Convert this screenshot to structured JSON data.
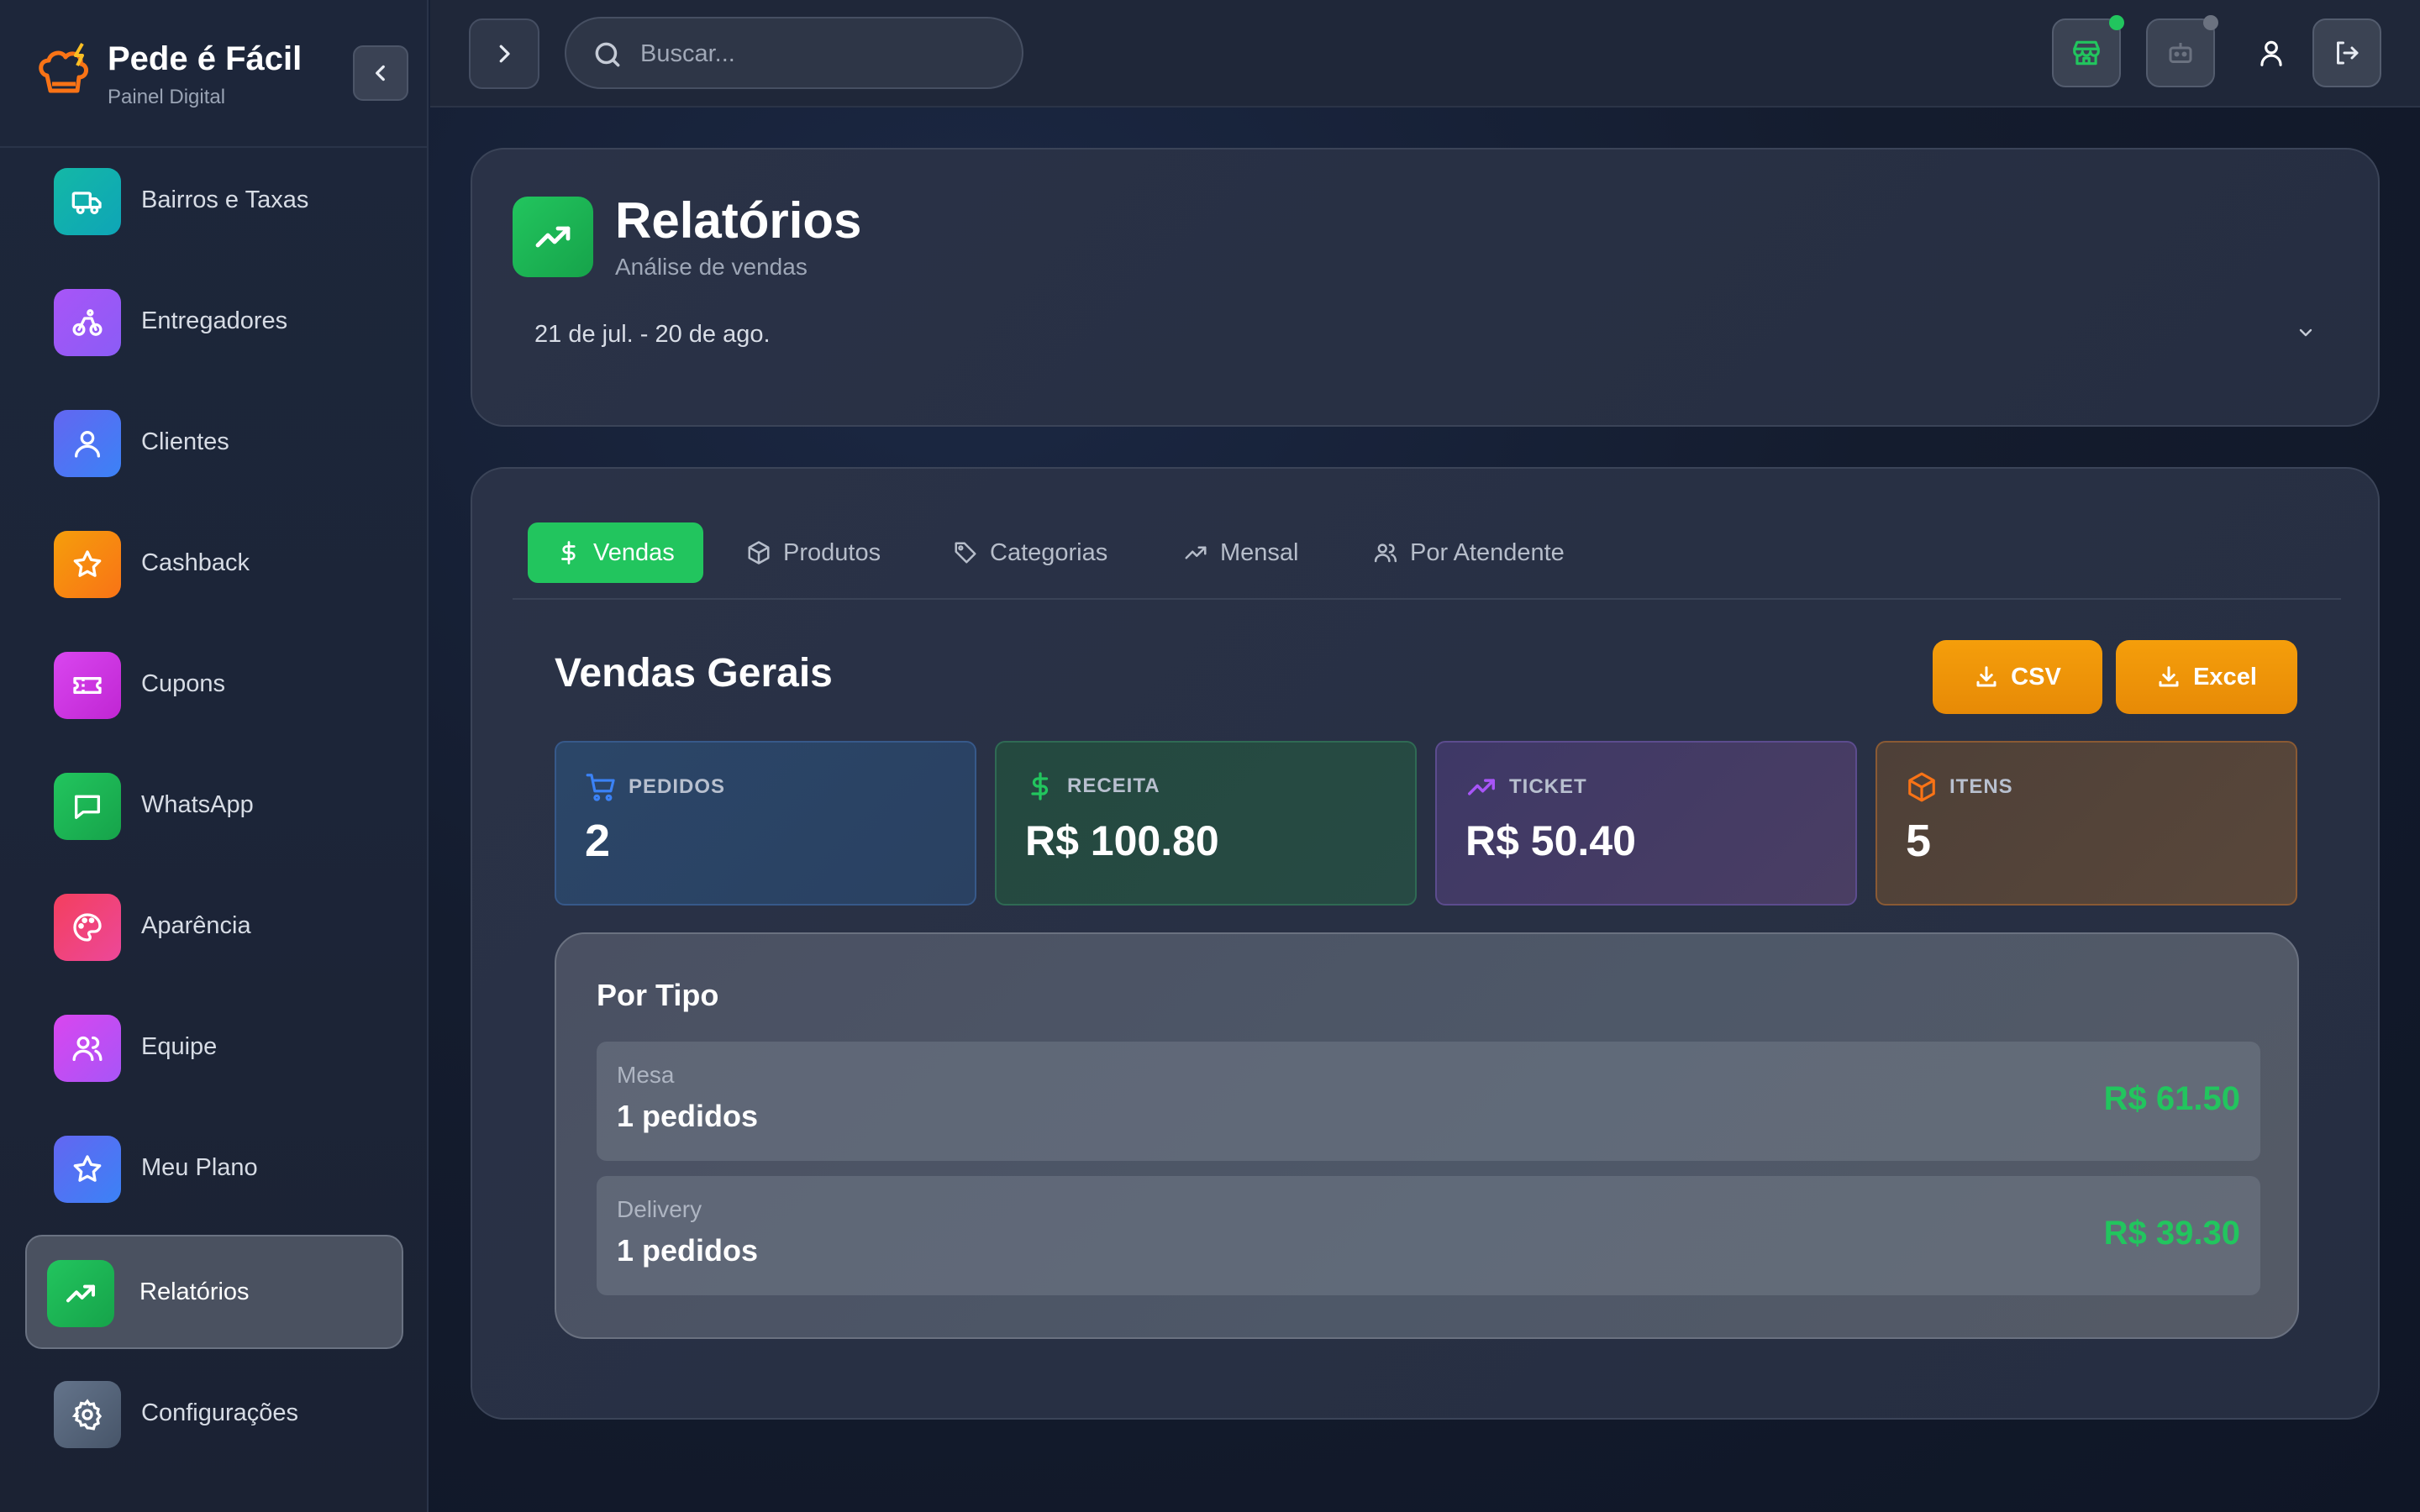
{
  "brand": {
    "title": "Pede é Fácil",
    "subtitle": "Painel Digital"
  },
  "sidebar": {
    "items": [
      {
        "label": "Bairros e Taxas",
        "icon": "truck-icon",
        "color": "#14b8a6"
      },
      {
        "label": "Entregadores",
        "icon": "bike-icon",
        "color": "#a855f7"
      },
      {
        "label": "Clientes",
        "icon": "user-icon",
        "color": "#6366f1"
      },
      {
        "label": "Cashback",
        "icon": "star-icon",
        "color": "#f59e0b"
      },
      {
        "label": "Cupons",
        "icon": "ticket-icon",
        "color": "#d946ef"
      },
      {
        "label": "WhatsApp",
        "icon": "message-icon",
        "color": "#22c55e"
      },
      {
        "label": "Aparência",
        "icon": "palette-icon",
        "color": "#f43f5e"
      },
      {
        "label": "Equipe",
        "icon": "users-icon",
        "color": "#d946ef"
      },
      {
        "label": "Meu Plano",
        "icon": "star-icon",
        "color": "#6366f1"
      },
      {
        "label": "Relatórios",
        "icon": "trending-up-icon",
        "color": "#22c55e",
        "active": true
      },
      {
        "label": "Configurações",
        "icon": "gear-icon",
        "color": "#64748b"
      }
    ]
  },
  "topbar": {
    "search_placeholder": "Buscar...",
    "store_status_color": "#22c55e",
    "bot_status_color": "#6b7280"
  },
  "header": {
    "title": "Relatórios",
    "subtitle": "Análise de vendas",
    "date_range": "21 de jul. - 20 de ago."
  },
  "tabs": [
    {
      "label": "Vendas",
      "icon": "dollar-icon",
      "active": true
    },
    {
      "label": "Produtos",
      "icon": "box-icon"
    },
    {
      "label": "Categorias",
      "icon": "tag-icon"
    },
    {
      "label": "Mensal",
      "icon": "trending-up-icon"
    },
    {
      "label": "Por Atendente",
      "icon": "users-icon"
    }
  ],
  "section": {
    "title": "Vendas Gerais",
    "csv_label": "CSV",
    "excel_label": "Excel"
  },
  "stats": [
    {
      "label": "PEDIDOS",
      "value": "2",
      "icon": "cart-icon",
      "color": "#3b82f6"
    },
    {
      "label": "RECEITA",
      "value": "R$ 100.80",
      "icon": "dollar-icon",
      "color": "#22c55e"
    },
    {
      "label": "TICKET",
      "value": "R$ 50.40",
      "icon": "trending-up-icon",
      "color": "#a855f7"
    },
    {
      "label": "ITENS",
      "value": "5",
      "icon": "box-icon",
      "color": "#f97316"
    }
  ],
  "by_type": {
    "title": "Por Tipo",
    "rows": [
      {
        "name": "Mesa",
        "count": "1 pedidos",
        "value": "R$ 61.50"
      },
      {
        "name": "Delivery",
        "count": "1 pedidos",
        "value": "R$ 39.30"
      }
    ]
  }
}
